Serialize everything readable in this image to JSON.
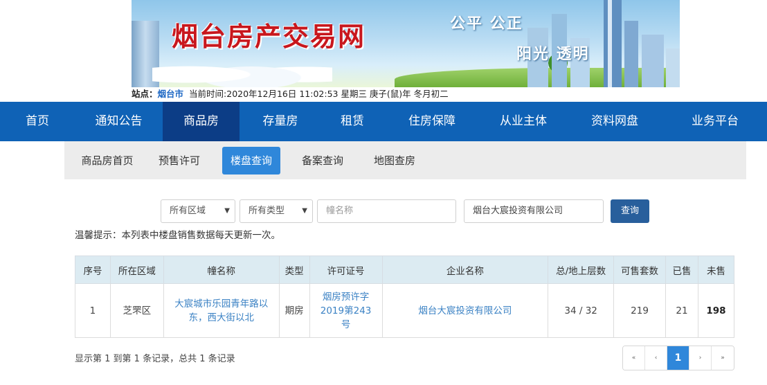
{
  "banner": {
    "title": "烟台房产交易网",
    "slogan_line1": "公平 公正",
    "slogan_line2": "阳光 透明"
  },
  "sitebar": {
    "station_label": "站点：",
    "city": "烟台市",
    "time_text": "当前时间:2020年12月16日 11:02:53 星期三 庚子(鼠)年 冬月初二"
  },
  "main_nav": {
    "items": [
      {
        "label": "首页"
      },
      {
        "label": "通知公告"
      },
      {
        "label": "商品房",
        "active": true
      },
      {
        "label": "存量房"
      },
      {
        "label": "租赁"
      },
      {
        "label": "住房保障"
      },
      {
        "label": "从业主体"
      },
      {
        "label": "资料网盘"
      },
      {
        "label": "业务平台"
      }
    ]
  },
  "sub_nav": {
    "items": [
      {
        "label": "商品房首页"
      },
      {
        "label": "预售许可"
      },
      {
        "label": "楼盘查询",
        "active": true
      },
      {
        "label": "备案查询"
      },
      {
        "label": "地图查房"
      }
    ]
  },
  "search": {
    "region_select": "所有区域",
    "type_select": "所有类型",
    "building_name_placeholder": "幢名称",
    "company_value": "烟台大宸投资有限公司",
    "search_button": "查询"
  },
  "notice": "温馨提示：本列表中楼盘销售数据每天更新一次。",
  "table": {
    "headers": [
      "序号",
      "所在区域",
      "幢名称",
      "类型",
      "许可证号",
      "企业名称",
      "总/地上层数",
      "可售套数",
      "已售",
      "未售"
    ],
    "rows": [
      {
        "no": "1",
        "region": "芝罘区",
        "building": "大宸城市乐园青年路以东，西大街以北",
        "type": "期房",
        "permit": "烟房预许字2019第243号",
        "company": "烟台大宸投资有限公司",
        "floors": "34 / 32",
        "available": "219",
        "sold": "21",
        "unsold": "198"
      }
    ]
  },
  "summary": "显示第 1 到第 1 条记录，总共 1 条记录",
  "pager": {
    "first": "«",
    "prev": "‹",
    "current": "1",
    "next": "›",
    "last": "»"
  },
  "colors": {
    "nav_bg": "#0f62b6",
    "nav_active": "#0c3d86",
    "accent": "#2f87da",
    "title_red": "#c8171d",
    "table_header_bg": "#dcebf2",
    "link": "#3b82c4"
  }
}
